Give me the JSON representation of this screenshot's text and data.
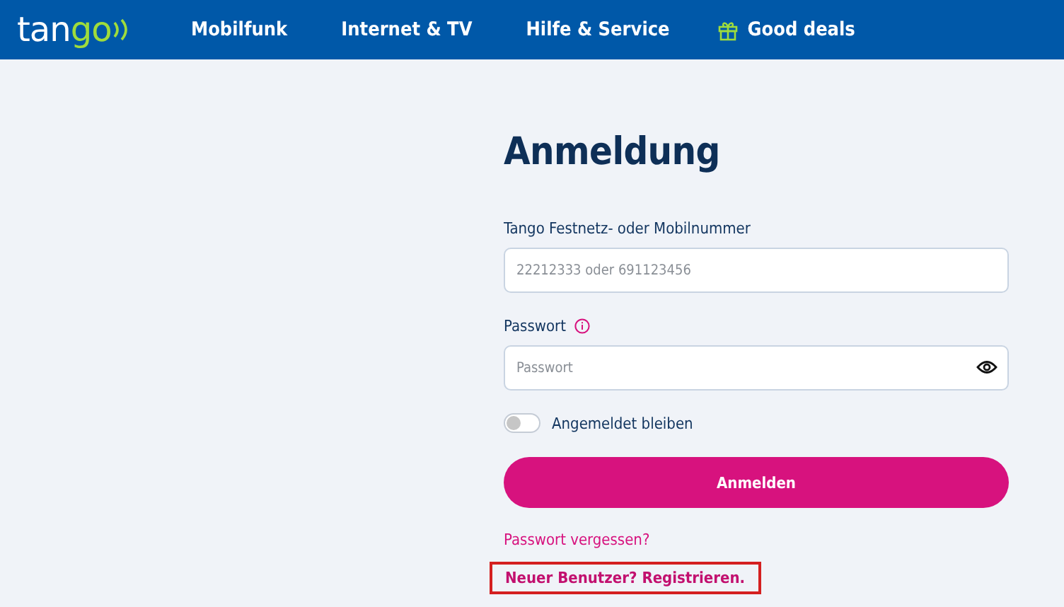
{
  "header": {
    "logo": {
      "main": "tan",
      "accent": "go"
    },
    "nav": [
      {
        "label": "Mobilfunk",
        "kind": "plain"
      },
      {
        "label": "Internet & TV",
        "kind": "plain"
      },
      {
        "label": "Hilfe & Service",
        "kind": "plain"
      },
      {
        "label": "Good deals",
        "kind": "gift"
      }
    ]
  },
  "login": {
    "title": "Anmeldung",
    "number_field": {
      "label": "Tango Festnetz- oder Mobilnummer",
      "placeholder": "22212333 oder 691123456"
    },
    "password_field": {
      "label": "Passwort",
      "placeholder": "Passwort"
    },
    "stay_logged_in": {
      "label": "Angemeldet bleiben",
      "on": false
    },
    "submit": "Anmelden",
    "forgot_link": "Passwort vergessen?",
    "register_link": {
      "text": "Neuer Benutzer? Registrieren.",
      "highlighted": true
    }
  }
}
